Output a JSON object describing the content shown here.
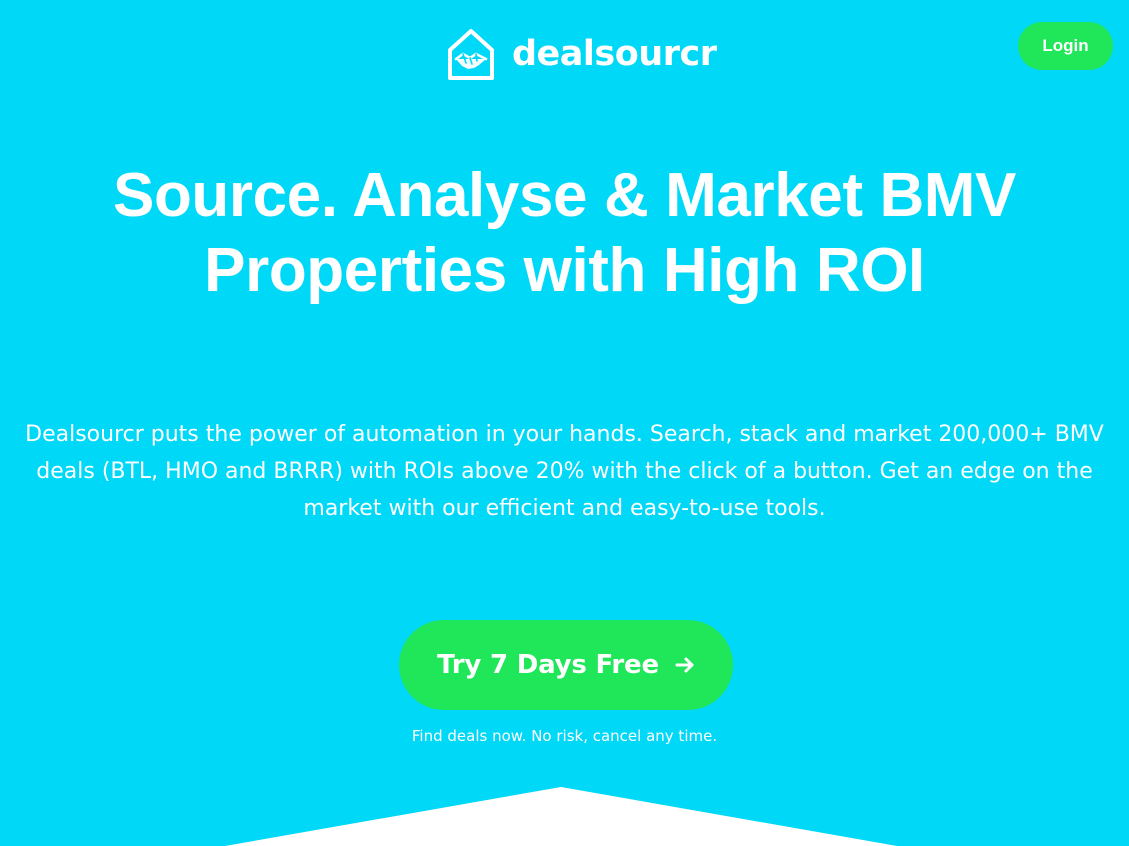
{
  "header": {
    "brand_name": "dealsourcr",
    "logo_icon": "handshake-house-icon",
    "login_label": "Login"
  },
  "hero": {
    "headline_line_1": "Source. Analyse & Market BMV",
    "headline_line_2": "Properties with High ROI",
    "intro": "Dealsourcr puts the power of automation in your hands. Search, stack and market 200,000+ BMV deals (BTL, HMO and BRRR) with ROIs above 20% with the click of a button. Get an edge on the market with our efficient and easy-to-use tools.",
    "cta_label": "Try 7 Days Free",
    "cta_icon": "arrow-right-icon",
    "cta_note": "Find deals now. No risk, cancel any time."
  },
  "colors": {
    "background": "#00d8f8",
    "accent_green": "#20e65a",
    "text": "#ffffff"
  }
}
